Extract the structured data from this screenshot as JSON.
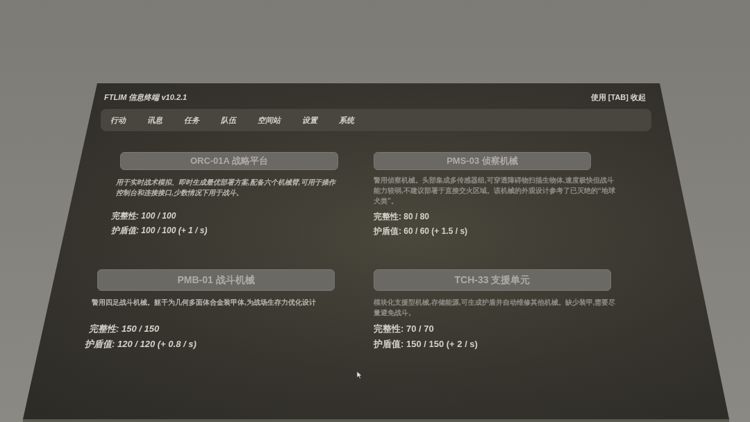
{
  "header": {
    "title": "FTLIM 信息终端 v10.2.1",
    "hint": "使用 [TAB] 收起"
  },
  "tabs": [
    {
      "label": "行动"
    },
    {
      "label": "讯息"
    },
    {
      "label": "任务"
    },
    {
      "label": "队伍"
    },
    {
      "label": "空间站"
    },
    {
      "label": "设置"
    },
    {
      "label": "系统"
    }
  ],
  "units": [
    {
      "name": "ORC-01A 战略平台",
      "description": "用于实时战术模拟、即时生成最优部署方案,配备六个机械臂,可用于操作控制台和连接接口,少数情况下用于战斗。",
      "stats": [
        "完整性: 100 / 100",
        "护盾值: 100 / 100 (+ 1 / s)"
      ]
    },
    {
      "name": "PMS-03 侦察机械",
      "description": "警用侦察机械。头部集成多传感器组,可穿透障碍物扫描生物体,速度极快但战斗能力较弱,不建议部署于直接交火区域。该机械的外观设计参考了已灭绝的“地球犬类”。",
      "stats": [
        "完整性: 80 / 80",
        "护盾值: 60 / 60 (+ 1.5 / s)"
      ]
    },
    {
      "name": "PMB-01 战斗机械",
      "description": "警用四足战斗机械。躯干为几何多面体合金装甲体,为战场生存力优化设计",
      "stats": [
        "完整性: 150 / 150",
        "护盾值: 120 / 120 (+ 0.8 / s)"
      ]
    },
    {
      "name": "TCH-33 支援单元",
      "description": "模块化支援型机械,存储能源,可生成护盾并自动维修其他机械。缺少装甲,需要尽量避免战斗。",
      "stats": [
        "完整性: 70 / 70",
        "护盾值: 150 / 150 (+ 2 / s)"
      ]
    }
  ]
}
